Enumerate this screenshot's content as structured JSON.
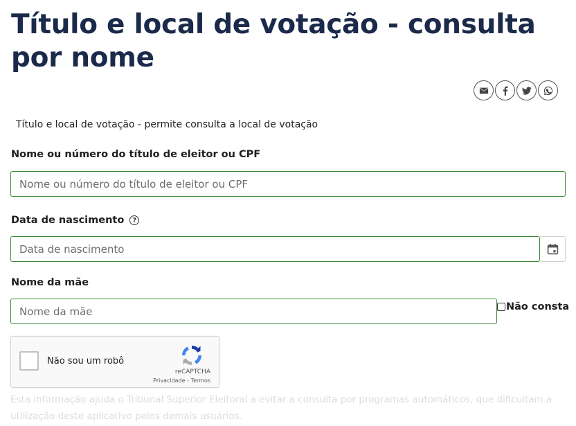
{
  "page": {
    "title": "Título e local de votação - consulta por nome",
    "intro": "Título e local de votação - permite consulta a local de votação"
  },
  "share": {
    "icons": [
      "email-icon",
      "facebook-icon",
      "twitter-icon",
      "whatsapp-icon"
    ]
  },
  "form": {
    "name_field": {
      "label": "Nome ou número do título de eleitor ou CPF",
      "placeholder": "Nome ou número do título de eleitor ou CPF",
      "value": ""
    },
    "birth_field": {
      "label": "Data de nascimento",
      "help_icon": "question-circle-icon",
      "placeholder": "Data de nascimento",
      "value": "",
      "calendar_icon": "calendar-icon"
    },
    "mother_field": {
      "label": "Nome da mãe",
      "placeholder": "Nome da mãe",
      "value": "",
      "not_listed_label": "Não consta",
      "not_listed_checked": false
    }
  },
  "recaptcha": {
    "label": "Não sou um robô",
    "brand": "reCAPTCHA",
    "links": "Privacidade - Termos",
    "checked": false
  },
  "disclaimer": "Esta informação ajuda o Tribunal Superior Eleitoral a evitar a consulta por programas automáticos, que dificultam a utilização deste aplicativo pelos demais usuários.",
  "colors": {
    "title": "#1b2a4a",
    "input_border": "#3a8a3a",
    "disclaimer_text": "#dcdcdc"
  }
}
